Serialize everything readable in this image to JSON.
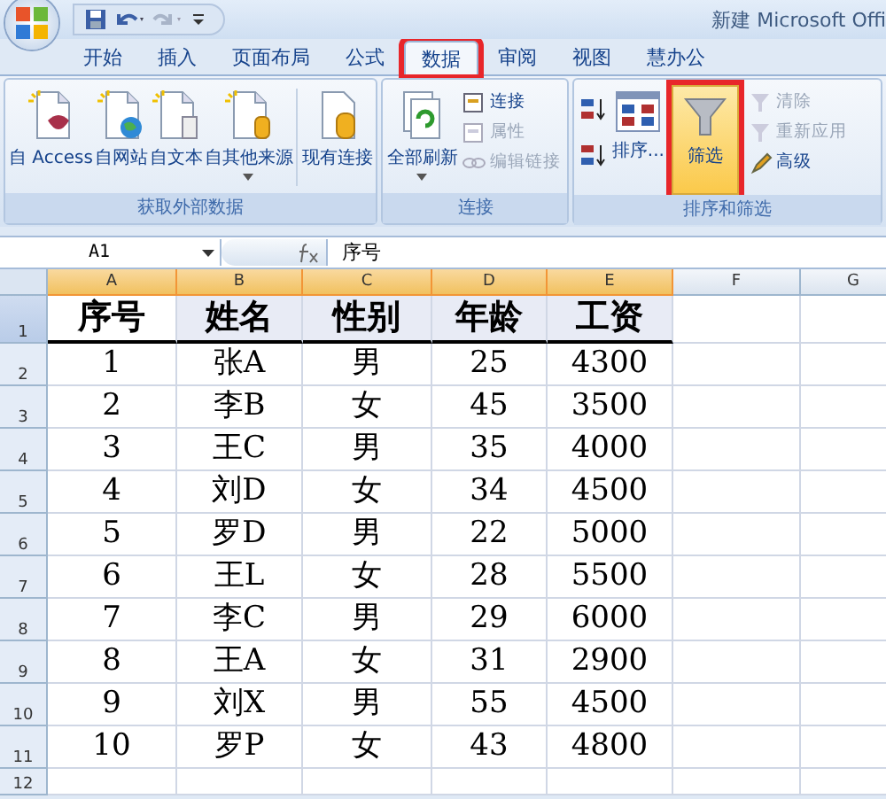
{
  "window": {
    "title": "新建 Microsoft Offi"
  },
  "tabs": [
    {
      "label": "开始",
      "selected": false,
      "highlighted": false
    },
    {
      "label": "插入",
      "selected": false,
      "highlighted": false
    },
    {
      "label": "页面布局",
      "selected": false,
      "highlighted": false
    },
    {
      "label": "公式",
      "selected": false,
      "highlighted": false
    },
    {
      "label": "数据",
      "selected": true,
      "highlighted": true
    },
    {
      "label": "审阅",
      "selected": false,
      "highlighted": false
    },
    {
      "label": "视图",
      "selected": false,
      "highlighted": false
    },
    {
      "label": "慧办公",
      "selected": false,
      "highlighted": false
    }
  ],
  "ribbon": {
    "groups": [
      {
        "label": "获取外部数据",
        "large": [
          {
            "label": "自 Access"
          },
          {
            "label": "自网站"
          },
          {
            "label": "自文本"
          },
          {
            "label": "自其他来源"
          },
          {
            "label": "现有连接"
          }
        ]
      },
      {
        "label": "连接",
        "large": [
          {
            "label": "全部刷新"
          }
        ],
        "small": [
          {
            "label": "连接",
            "disabled": false
          },
          {
            "label": "属性",
            "disabled": true
          },
          {
            "label": "编辑链接",
            "disabled": true
          }
        ]
      },
      {
        "label": "排序和筛选",
        "large": [
          {
            "label": "排序...",
            "selected": false,
            "highlighted": false
          },
          {
            "label": "筛选",
            "selected": true,
            "highlighted": true
          }
        ],
        "small": [
          {
            "label": "清除",
            "disabled": true
          },
          {
            "label": "重新应用",
            "disabled": true
          },
          {
            "label": "高级",
            "disabled": false
          }
        ]
      }
    ]
  },
  "formula_bar": {
    "name_box": "A1",
    "formula": "序号"
  },
  "sheet": {
    "columns": [
      {
        "label": "A",
        "selected": true
      },
      {
        "label": "B",
        "selected": true
      },
      {
        "label": "C",
        "selected": true
      },
      {
        "label": "D",
        "selected": true
      },
      {
        "label": "E",
        "selected": true
      },
      {
        "label": "F",
        "selected": false
      },
      {
        "label": "G",
        "selected": false
      }
    ],
    "rows": [
      {
        "number": "1",
        "kind": "header",
        "selected": true,
        "cells": [
          {
            "text": "序号",
            "active": true
          },
          {
            "text": "姓名",
            "active": false
          },
          {
            "text": "性别",
            "active": false
          },
          {
            "text": "年龄",
            "active": false
          },
          {
            "text": "工资",
            "active": false
          }
        ]
      },
      {
        "number": "2",
        "kind": "data",
        "cells": [
          "1",
          "张A",
          "男",
          "25",
          "4300"
        ]
      },
      {
        "number": "3",
        "kind": "data",
        "cells": [
          "2",
          "李B",
          "女",
          "45",
          "3500"
        ]
      },
      {
        "number": "4",
        "kind": "data",
        "cells": [
          "3",
          "王C",
          "男",
          "35",
          "4000"
        ]
      },
      {
        "number": "5",
        "kind": "data",
        "cells": [
          "4",
          "刘D",
          "女",
          "34",
          "4500"
        ]
      },
      {
        "number": "6",
        "kind": "data",
        "cells": [
          "5",
          "罗D",
          "男",
          "22",
          "5000"
        ]
      },
      {
        "number": "7",
        "kind": "data",
        "cells": [
          "6",
          "王L",
          "女",
          "28",
          "5500"
        ]
      },
      {
        "number": "8",
        "kind": "data",
        "cells": [
          "7",
          "李C",
          "男",
          "29",
          "6000"
        ]
      },
      {
        "number": "9",
        "kind": "data",
        "cells": [
          "8",
          "王A",
          "女",
          "31",
          "2900"
        ]
      },
      {
        "number": "10",
        "kind": "data",
        "cells": [
          "9",
          "刘X",
          "男",
          "55",
          "4500"
        ]
      },
      {
        "number": "11",
        "kind": "data",
        "cells": [
          "10",
          "罗P",
          "女",
          "43",
          "4800"
        ]
      },
      {
        "number": "12",
        "kind": "empty",
        "cells": []
      }
    ]
  }
}
